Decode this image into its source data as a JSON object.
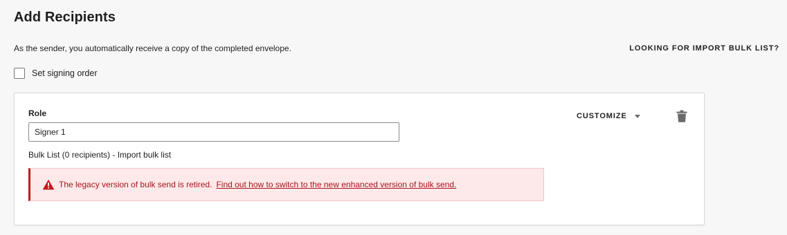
{
  "header": {
    "title": "Add Recipients",
    "sender_note": "As the sender, you automatically receive a copy of the completed envelope.",
    "import_bulk_list_link": "LOOKING FOR IMPORT BULK LIST?"
  },
  "signing_order": {
    "label": "Set signing order",
    "checked": false
  },
  "recipient": {
    "role_label": "Role",
    "role_value": "Signer 1",
    "bulk_list_text": "Bulk List (0 recipients) - Import bulk list",
    "customize_label": "CUSTOMIZE",
    "alert": {
      "message": "The legacy version of bulk send is retired.",
      "link_text": "Find out how to switch to the new enhanced version of bulk send.",
      "icon": "warning-triangle-icon",
      "color": "#c4191f"
    },
    "delete_icon": "trash-icon"
  }
}
